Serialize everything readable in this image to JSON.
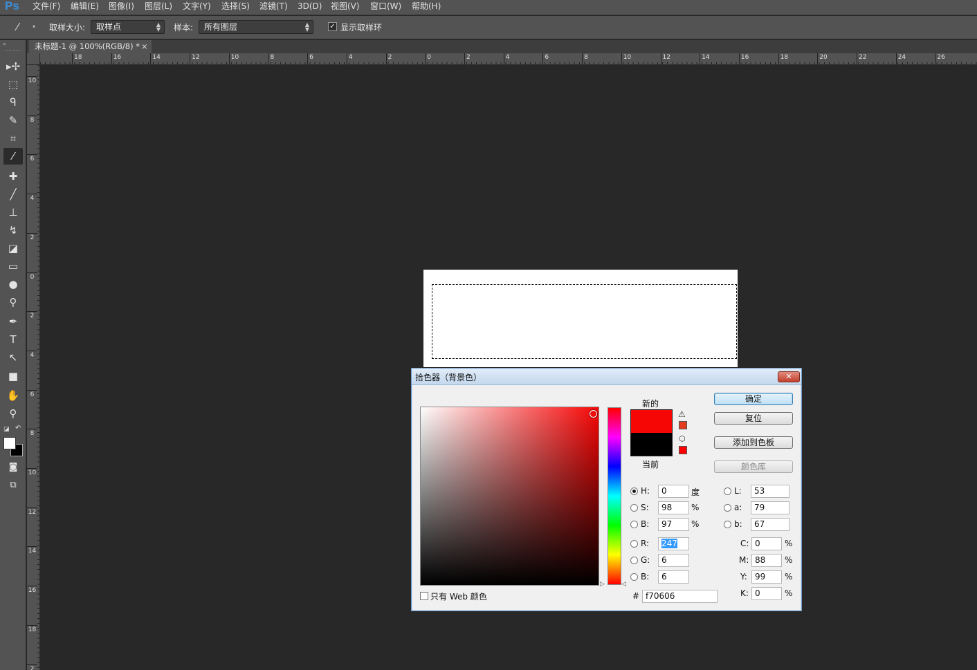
{
  "app": {
    "logo": "Ps"
  },
  "menu": [
    "文件(F)",
    "编辑(E)",
    "图像(I)",
    "图层(L)",
    "文字(Y)",
    "选择(S)",
    "滤镜(T)",
    "3D(D)",
    "视图(V)",
    "窗口(W)",
    "帮助(H)"
  ],
  "options": {
    "sample_size_label": "取样大小:",
    "sample_size_value": "取样点",
    "sample_label": "样本:",
    "sample_value": "所有图层",
    "show_ring_label": "显示取样环",
    "show_ring_checked": true
  },
  "doc_tab": {
    "title": "未标题-1 @ 100%(RGB/8) *",
    "close": "×"
  },
  "ruler": {
    "h_labels": [
      "18",
      "16",
      "14",
      "12",
      "10",
      "8",
      "6",
      "4",
      "2",
      "0",
      "2",
      "4",
      "6",
      "8",
      "10",
      "12",
      "14",
      "16",
      "18",
      "20",
      "22",
      "24",
      "26"
    ],
    "v_labels": [
      "10",
      "8",
      "6",
      "4",
      "2",
      "0",
      "2",
      "4",
      "6",
      "8",
      "10",
      "12",
      "14",
      "16",
      "18",
      "2"
    ]
  },
  "tools": [
    {
      "name": "move-tool-icon",
      "glyph": "▸✢"
    },
    {
      "name": "marquee-tool-icon",
      "glyph": "⬚"
    },
    {
      "name": "lasso-tool-icon",
      "glyph": "ᑫ"
    },
    {
      "name": "quick-select-tool-icon",
      "glyph": "✎"
    },
    {
      "name": "crop-tool-icon",
      "glyph": "⌗"
    },
    {
      "name": "eyedropper-tool-icon",
      "glyph": "⁄"
    },
    {
      "name": "healing-brush-tool-icon",
      "glyph": "✚"
    },
    {
      "name": "brush-tool-icon",
      "glyph": "╱"
    },
    {
      "name": "stamp-tool-icon",
      "glyph": "⊥"
    },
    {
      "name": "history-brush-tool-icon",
      "glyph": "↯"
    },
    {
      "name": "eraser-tool-icon",
      "glyph": "◪"
    },
    {
      "name": "gradient-tool-icon",
      "glyph": "▭"
    },
    {
      "name": "blur-tool-icon",
      "glyph": "●"
    },
    {
      "name": "dodge-tool-icon",
      "glyph": "⚲"
    },
    {
      "name": "pen-tool-icon",
      "glyph": "✒"
    },
    {
      "name": "type-tool-icon",
      "glyph": "T"
    },
    {
      "name": "path-select-tool-icon",
      "glyph": "↖"
    },
    {
      "name": "rectangle-tool-icon",
      "glyph": "■"
    },
    {
      "name": "hand-tool-icon",
      "glyph": "✋"
    },
    {
      "name": "zoom-tool-icon",
      "glyph": "⚲"
    }
  ],
  "colors": {
    "foreground": "#ffffff",
    "background": "#000000",
    "picked": "#f70606",
    "current": "#000000"
  },
  "dialog": {
    "title": "拾色器（背景色）",
    "close": "✕",
    "new_label": "新的",
    "current_label": "当前",
    "buttons": {
      "ok": "确定",
      "reset": "复位",
      "add_swatch": "添加到色板",
      "library": "颜色库"
    },
    "hsb": [
      {
        "label": "H:",
        "value": "0",
        "unit": "度",
        "selected": true
      },
      {
        "label": "S:",
        "value": "98",
        "unit": "%",
        "selected": false
      },
      {
        "label": "B:",
        "value": "97",
        "unit": "%",
        "selected": false
      }
    ],
    "rgb": [
      {
        "label": "R:",
        "value": "247"
      },
      {
        "label": "G:",
        "value": "6"
      },
      {
        "label": "B:",
        "value": "6"
      }
    ],
    "lab": [
      {
        "label": "L:",
        "value": "53"
      },
      {
        "label": "a:",
        "value": "79"
      },
      {
        "label": "b:",
        "value": "67"
      }
    ],
    "cmyk": [
      {
        "label": "C:",
        "value": "0",
        "unit": "%"
      },
      {
        "label": "M:",
        "value": "88",
        "unit": "%"
      },
      {
        "label": "Y:",
        "value": "99",
        "unit": "%"
      },
      {
        "label": "K:",
        "value": "0",
        "unit": "%"
      }
    ],
    "hex_label": "#",
    "hex_value": "f70606",
    "web_only_label": "只有 Web 颜色",
    "web_only_checked": false
  }
}
